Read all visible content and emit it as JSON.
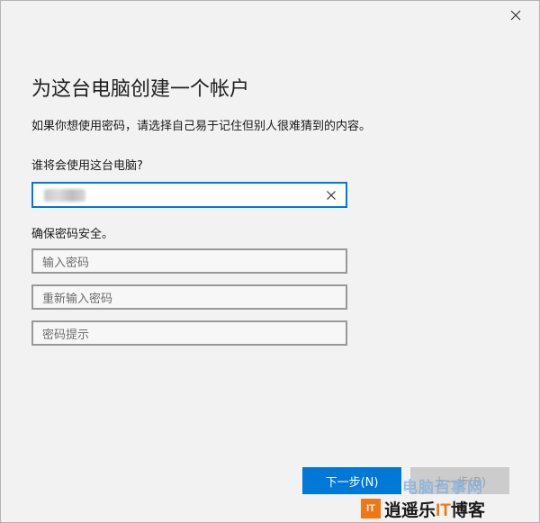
{
  "window": {
    "close_icon": "close-icon"
  },
  "page": {
    "title": "为这台电脑创建一个帐户",
    "description": "如果你想使用密码，请选择自己易于记住但别人很难猜到的内容。"
  },
  "user_section": {
    "label": "谁将会使用这台电脑?",
    "value_blurred": true
  },
  "password_section": {
    "label": "确保密码安全。",
    "password_placeholder": "输入密码",
    "reenter_placeholder": "重新输入密码",
    "hint_placeholder": "密码提示"
  },
  "buttons": {
    "next": "下一步(N)",
    "back": "上一步(B)"
  },
  "watermark": {
    "site": "电脑百事网",
    "badge": "IT",
    "blog_pre": "逍遥乐",
    "blog_it": "IT",
    "blog_post": "博客"
  },
  "colors": {
    "accent": "#0078d7",
    "background": "#f2f2f2",
    "watermark_orange": "#f07814"
  }
}
